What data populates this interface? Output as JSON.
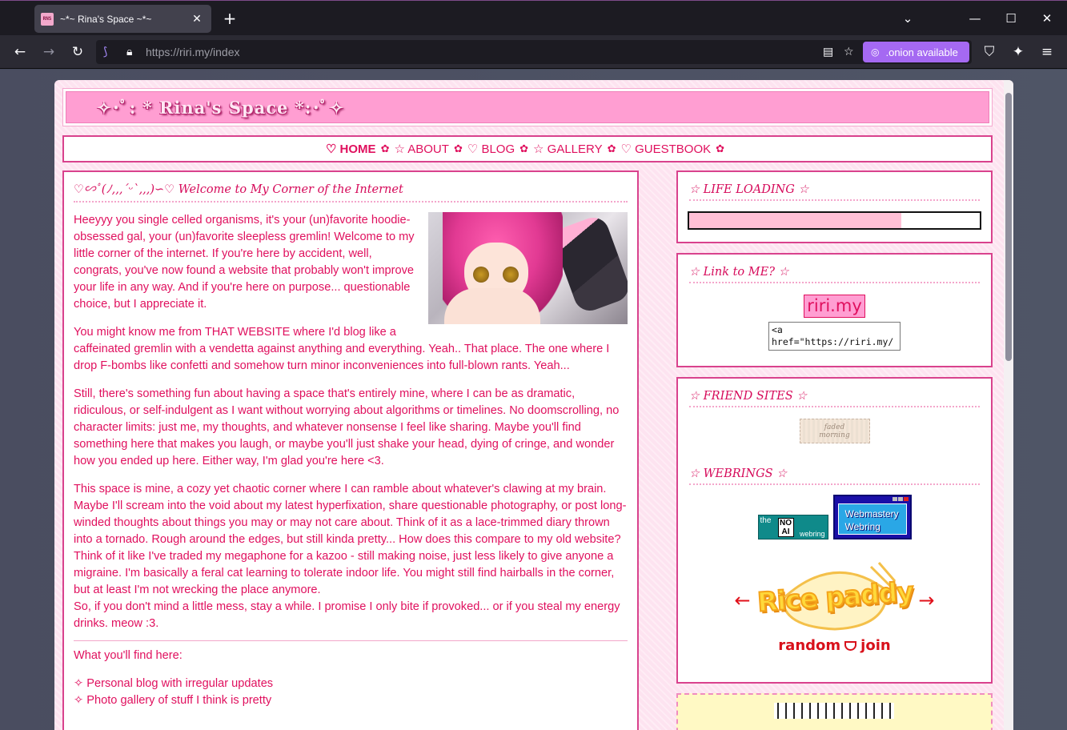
{
  "browser": {
    "tab_title": "~*~ Rina's Space ~*~",
    "favicon_text": "RNS",
    "url_host": "https://riri.my",
    "url_path": "/index",
    "onion_label": ".onion available",
    "icons": [
      "back-arrow-icon",
      "forward-arrow-icon",
      "reload-icon",
      "tracking-icon",
      "lock-icon",
      "reader-icon",
      "star-icon",
      "shield-icon",
      "extensions-icon",
      "menu-icon"
    ]
  },
  "site": {
    "title": "✧･ﾟ: * Rina's Space *:･ﾟ✧",
    "nav": [
      {
        "label": "♡ HOME",
        "active": true
      },
      {
        "label": "☆ ABOUT"
      },
      {
        "label": "♡ BLOG"
      },
      {
        "label": "☆ GALLERY"
      },
      {
        "label": "♡ GUESTBOOK"
      }
    ],
    "nav_sep": "✿"
  },
  "main": {
    "title": "♡∽ﾟ(ﾉ,,,´ᵕ`,,,)∽♡ Welcome to My Corner of the Internet",
    "paragraphs": [
      "Heeyyy you single celled organisms, it's your (un)favorite hoodie-obsessed gal, your (un)favorite sleepless gremlin! Welcome to my little corner of the internet. If you're here by accident, well, congrats, you've now found a website that probably won't improve your life in any way. And if you're here on purpose... questionable choice, but I appreciate it.",
      "You might know me from THAT WEBSITE where I'd blog like a caffeinated gremlin with a vendetta against anything and everything. Yeah.. That place. The one where I drop F-bombs like confetti and somehow turn minor inconveniences into full-blown rants. Yeah...",
      "Still, there's something fun about having a space that's entirely mine, where I can be as dramatic, ridiculous, or self-indulgent as I want without worrying about algorithms or timelines. No doomscrolling, no character limits: just me, my thoughts, and whatever nonsense I feel like sharing. Maybe you'll find something here that makes you laugh, or maybe you'll just shake your head, dying of cringe, and wonder how you ended up here. Either way, I'm glad you're here <3.",
      "This space is mine, a cozy yet chaotic corner where I can ramble about whatever's clawing at my brain. Maybe I'll scream into the void about my latest hyperfixation, share questionable photography, or post long-winded thoughts about things you may or may not care about. Think of it as a lace-trimmed diary thrown into a tornado. Rough around the edges, but still kinda pretty... How does this compare to my old website? Think of it like I've traded my megaphone for a kazoo - still making noise, just less likely to give anyone a migraine. I'm basically a feral cat learning to tolerate indoor life. You might still find hairballs in the corner, but at least I'm not wrecking the place anymore."
    ],
    "closing": "So, if you don't mind a little mess, stay a while. I promise I only bite if provoked... or if you steal my energy drinks. meow :3.",
    "find_heading": "What you'll find here:",
    "find_list": [
      "✧ Personal blog with irregular updates",
      "✧ Photo gallery of stuff I think is pretty"
    ]
  },
  "sidebar": {
    "life_title": "☆ LIFE LOADING ☆",
    "life_progress": 0.73,
    "link_title": "☆ Link to ME? ☆",
    "link_badge": "riri.my",
    "link_code": "<a href=\"https://riri.my/\"",
    "friends_title": "☆ FRIEND SITES ☆",
    "friend_badge": "faded\nmorning",
    "webrings_title": "☆ WEBRINGS ☆",
    "noai_the": "the",
    "noai_text": "NO AI",
    "noai_webring": "webring",
    "webmastery_text": "Webmastery Webring",
    "ricepaddy_logo": "Rice paddy",
    "ricepaddy_random": "random",
    "ricepaddy_join": "join",
    "arrow_left": "←",
    "arrow_right": "→"
  },
  "colors": {
    "accent": "#e0105e",
    "border": "#d9428d",
    "header_bg": "#ff9ed2",
    "page_bg": "#fde3f0"
  }
}
